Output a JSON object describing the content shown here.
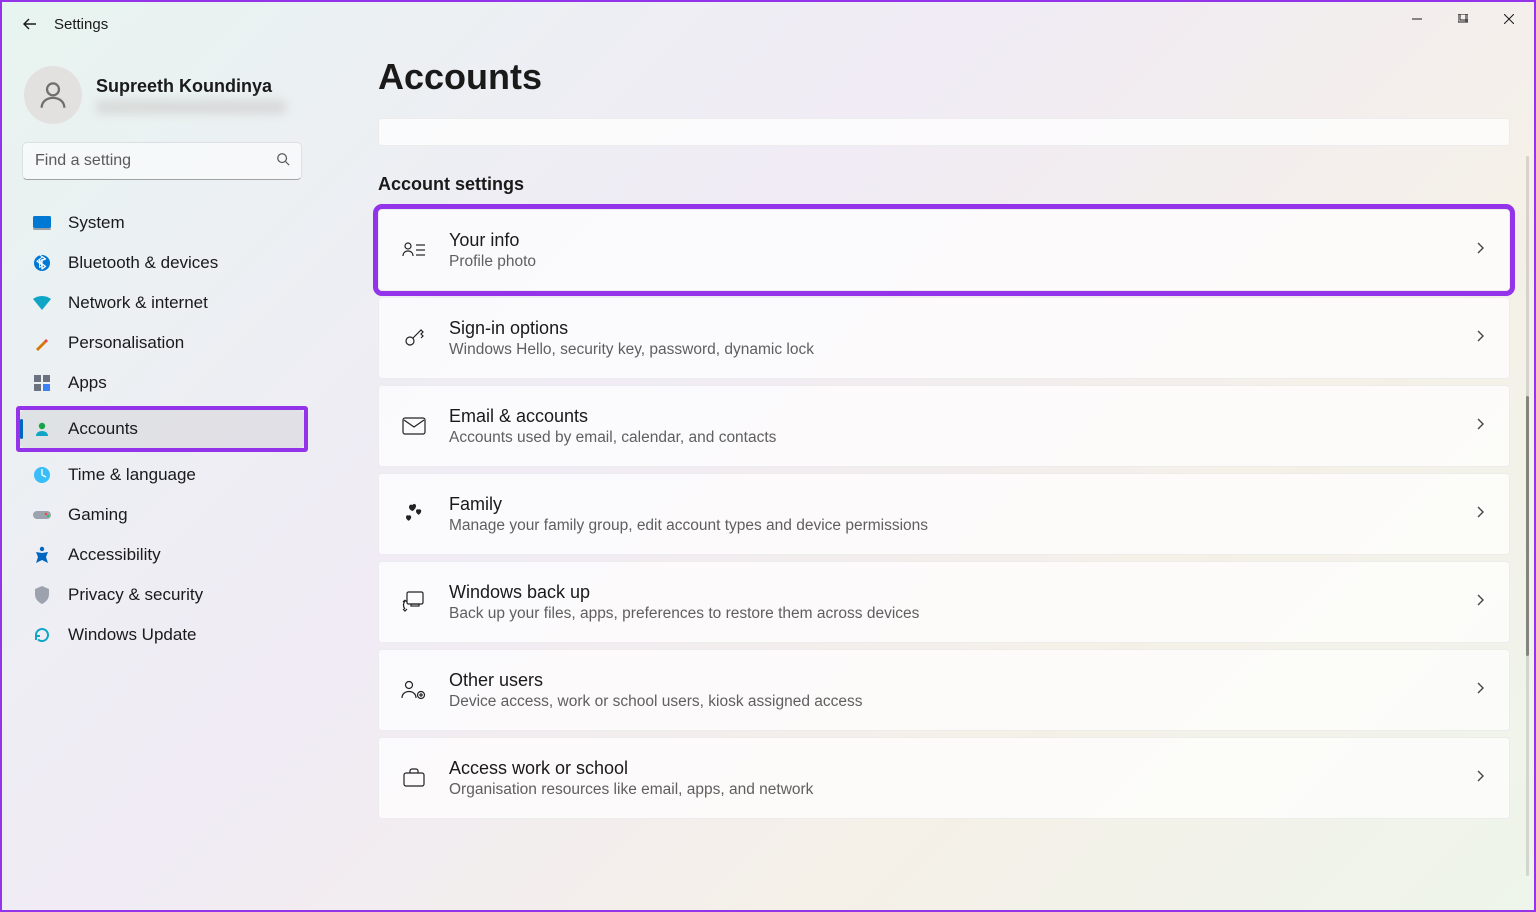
{
  "window": {
    "title": "Settings"
  },
  "user": {
    "name": "Supreeth Koundinya"
  },
  "search": {
    "placeholder": "Find a setting"
  },
  "nav": {
    "items": [
      {
        "label": "System"
      },
      {
        "label": "Bluetooth & devices"
      },
      {
        "label": "Network & internet"
      },
      {
        "label": "Personalisation"
      },
      {
        "label": "Apps"
      },
      {
        "label": "Accounts"
      },
      {
        "label": "Time & language"
      },
      {
        "label": "Gaming"
      },
      {
        "label": "Accessibility"
      },
      {
        "label": "Privacy & security"
      },
      {
        "label": "Windows Update"
      }
    ]
  },
  "page": {
    "title": "Accounts",
    "section": "Account settings",
    "cards": [
      {
        "title": "Your info",
        "sub": "Profile photo"
      },
      {
        "title": "Sign-in options",
        "sub": "Windows Hello, security key, password, dynamic lock"
      },
      {
        "title": "Email & accounts",
        "sub": "Accounts used by email, calendar, and contacts"
      },
      {
        "title": "Family",
        "sub": "Manage your family group, edit account types and device permissions"
      },
      {
        "title": "Windows back up",
        "sub": "Back up your files, apps, preferences to restore them across devices"
      },
      {
        "title": "Other users",
        "sub": "Device access, work or school users, kiosk assigned access"
      },
      {
        "title": "Access work or school",
        "sub": "Organisation resources like email, apps, and network"
      }
    ]
  }
}
